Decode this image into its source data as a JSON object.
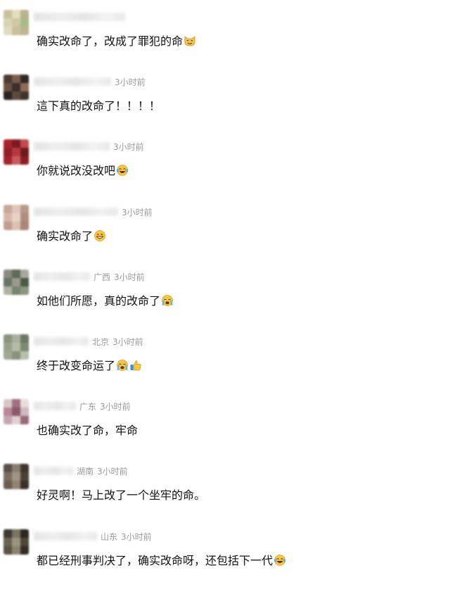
{
  "comments": [
    {
      "region": "",
      "time": "",
      "text": "确实改命了，改成了罪犯的命",
      "emojis": [
        "cat-face-icon"
      ],
      "avatar_colors": [
        "#c9c29c",
        "#e2ddbd",
        "#b9b28c",
        "#d8d2b0",
        "#cfc8a3",
        "#a9b98a",
        "#e0dac0",
        "#c7c09c",
        "#bdb690"
      ],
      "name_blur_width": 130
    },
    {
      "region": "",
      "time": "3小时前",
      "text": "這下真的改命了！！！！",
      "emojis": [],
      "avatar_colors": [
        "#4a3a30",
        "#7a5e4c",
        "#2e2824",
        "#6b5141",
        "#3a2e28",
        "#8d6b55",
        "#2a2420",
        "#5e4a3c",
        "#3f342c"
      ],
      "name_blur_width": 110
    },
    {
      "region": "",
      "time": "3小时前",
      "text": "你就说改没改吧",
      "emojis": [
        "laughing-tears-icon"
      ],
      "avatar_colors": [
        "#a8202a",
        "#7c1a22",
        "#c24a50",
        "#8f1e26",
        "#b8383e",
        "#6e1a1e",
        "#a0242c",
        "#c85a5e",
        "#8a1c24"
      ],
      "name_blur_width": 108
    },
    {
      "region": "",
      "time": "3小时前",
      "text": "确实改命了",
      "emojis": [
        "grinning-face-icon"
      ],
      "avatar_colors": [
        "#c8a89a",
        "#e0c6b8",
        "#b8988a",
        "#d8b8aa",
        "#e8d2c6",
        "#b08c7e",
        "#c09e90",
        "#dcc0b2",
        "#a88678"
      ],
      "name_blur_width": 120
    },
    {
      "region": "广西",
      "time": "3小时前",
      "text": "如他们所愿，真的改命了",
      "emojis": [
        "loudly-crying-icon"
      ],
      "avatar_colors": [
        "#8a8a80",
        "#5e6a58",
        "#a8a89c",
        "#6a7464",
        "#9a9a8e",
        "#4e5a48",
        "#b0b0a4",
        "#7a8470",
        "#8c9482"
      ],
      "name_blur_width": 80
    },
    {
      "region": "北京",
      "time": "3小时前",
      "text": "终于改变命运了",
      "emojis": [
        "loudly-crying-icon",
        "thumbs-up-icon"
      ],
      "avatar_colors": [
        "#8c9480",
        "#a8b09c",
        "#6e7864",
        "#9aa28e",
        "#b4bca8",
        "#7e8872",
        "#a0a894",
        "#8a927e",
        "#b8c0ac"
      ],
      "name_blur_width": 78
    },
    {
      "region": "广东",
      "time": "3小时前",
      "text": "也确实改了命，牢命",
      "emojis": [],
      "avatar_colors": [
        "#d8c8c8",
        "#a07080",
        "#e8dcdc",
        "#b88898",
        "#8a5a6a",
        "#d0b8c0",
        "#c8a8b0",
        "#e0d0d4",
        "#9a6a78"
      ],
      "name_blur_width": 60
    },
    {
      "region": "湖南",
      "time": "3小时前",
      "text": "好灵啊！马上改了一个坐牢的命。",
      "emojis": [],
      "avatar_colors": [
        "#5a5048",
        "#8a7e70",
        "#3e3630",
        "#7a6e62",
        "#a09484",
        "#4a423a",
        "#6a5e52",
        "#908474",
        "#38302a"
      ],
      "name_blur_width": 56
    },
    {
      "region": "山东",
      "time": "3小时前",
      "text": "都已经刑事判决了，确实改命呀，还包括下一代",
      "emojis": [
        "laughing-tears-icon"
      ],
      "avatar_colors": [
        "#3e3a30",
        "#7a7460",
        "#2a2820",
        "#6a6450",
        "#9a947e",
        "#4a4638",
        "#5a5444",
        "#8a846e",
        "#322e26"
      ],
      "name_blur_width": 90
    }
  ]
}
